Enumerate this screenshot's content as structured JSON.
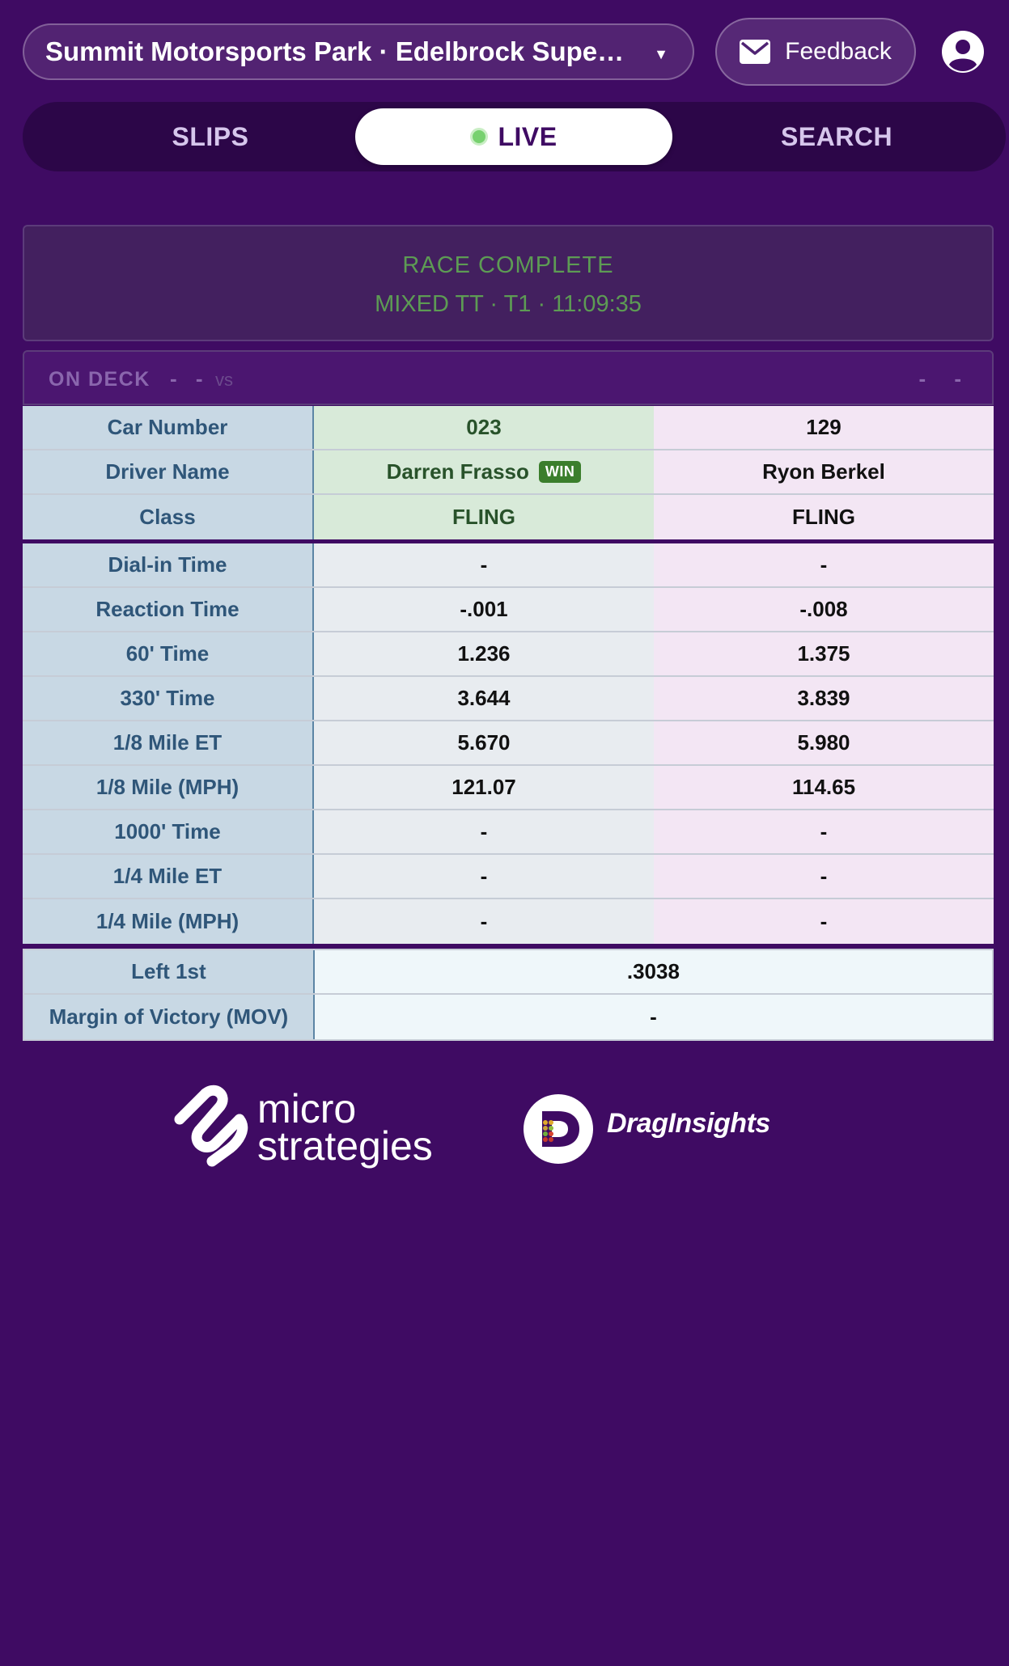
{
  "header": {
    "venue": "Summit Motorsports Park · Edelbrock Super ...",
    "feedback_label": "Feedback",
    "icons": {
      "feedback": "envelope-icon",
      "account": "user-circle-icon",
      "caret": "caret-down-icon"
    }
  },
  "tabs": [
    {
      "label": "SLIPS",
      "active": false
    },
    {
      "label": "LIVE",
      "active": true
    },
    {
      "label": "SEARCH",
      "active": false
    }
  ],
  "status": {
    "title": "RACE COMPLETE",
    "detail": "MIXED TT · T1 · 11:09:35",
    "color": "#5d9b54"
  },
  "on_deck": {
    "label": "ON DECK",
    "left": "- -",
    "vs": "vs",
    "right": "- -"
  },
  "race": {
    "top_rows": [
      {
        "label": "Car Number",
        "left": "023",
        "right": "129"
      },
      {
        "label": "Driver Name",
        "left": "Darren Frasso",
        "left_badge": "WIN",
        "right": "Ryon Berkel"
      },
      {
        "label": "Class",
        "left": "FLING",
        "right": "FLING"
      }
    ],
    "time_rows": [
      {
        "label": "Dial-in Time",
        "left": "-",
        "right": "-"
      },
      {
        "label": "Reaction Time",
        "left": "-.001",
        "right": "-.008"
      },
      {
        "label": "60' Time",
        "left": "1.236",
        "right": "1.375"
      },
      {
        "label": "330' Time",
        "left": "3.644",
        "right": "3.839"
      },
      {
        "label": "1/8 Mile ET",
        "left": "5.670",
        "right": "5.980"
      },
      {
        "label": "1/8 Mile (MPH)",
        "left": "121.07",
        "right": "114.65"
      },
      {
        "label": "1000' Time",
        "left": "-",
        "right": "-"
      },
      {
        "label": "1/4 Mile ET",
        "left": "-",
        "right": "-"
      },
      {
        "label": "1/4 Mile (MPH)",
        "left": "-",
        "right": "-"
      }
    ],
    "summary_rows": [
      {
        "label": "Left 1st",
        "value": ".3038"
      },
      {
        "label": "Margin of Victory (MOV)",
        "value": "-"
      }
    ]
  },
  "footer": {
    "logo1": {
      "line1": "micro",
      "line2": "strategies"
    },
    "logo2": {
      "text": "DragInsights"
    }
  },
  "colors": {
    "background": "#3f0b63",
    "tab_bar": "#2c0648",
    "winner_lane": "#d8ead9",
    "right_lane": "#f3e6f4",
    "label_column": "#c8d8e4",
    "win_badge": "#3b7e2c"
  }
}
